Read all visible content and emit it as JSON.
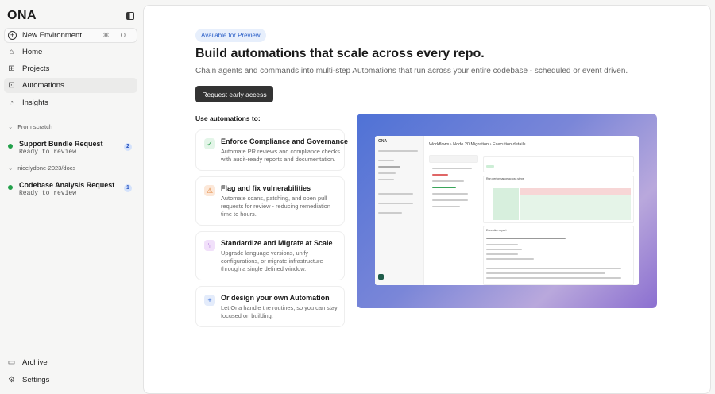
{
  "sidebar": {
    "logo": "ONA",
    "new_env": {
      "label": "New Environment",
      "shortcut": "⌘ O"
    },
    "nav": [
      {
        "label": "Home"
      },
      {
        "label": "Projects"
      },
      {
        "label": "Automations"
      },
      {
        "label": "Insights"
      }
    ],
    "groups": [
      {
        "label": "From scratch",
        "task": {
          "name": "Support Bundle Request",
          "status": "Ready to review",
          "count": "2"
        }
      },
      {
        "label": "nicelydone-2023/docs",
        "task": {
          "name": "Codebase Analysis Request",
          "status": "Ready to review",
          "count": "1"
        }
      }
    ],
    "archive": "Archive",
    "settings": "Settings"
  },
  "main": {
    "pill": "Available for Preview",
    "title": "Build automations that scale across every repo.",
    "subtitle": "Chain agents and commands into multi-step Automations that run across your entire codebase - scheduled or event driven.",
    "cta": "Request early access",
    "use_label": "Use automations to:",
    "cards": [
      {
        "title": "Enforce Compliance and Governance",
        "desc": "Automate PR reviews and compliance checks with audit-ready reports and documentation.",
        "icon": "shield-check-icon",
        "color": "#2a9d4a"
      },
      {
        "title": "Flag and fix vulnerabilities",
        "desc": "Automate scans, patching, and open pull requests for review - reducing remediation time to hours.",
        "icon": "warning-icon",
        "color": "#e07a2a"
      },
      {
        "title": "Standardize and Migrate at Scale",
        "desc": "Upgrade language versions, unify configurations, or migrate infrastructure through a single defined window.",
        "icon": "branch-icon",
        "color": "#9b4fd0"
      },
      {
        "title": "Or design your own Automation",
        "desc": "Let Ona handle the routines, so you can stay focused on building.",
        "icon": "plus-icon",
        "color": "#3b6fd8"
      }
    ],
    "preview": {
      "breadcrumb": "Workflows › Node 20 Migration › Execution details",
      "chart_title": "Run performance across steps",
      "report_title": "Execution report"
    }
  }
}
